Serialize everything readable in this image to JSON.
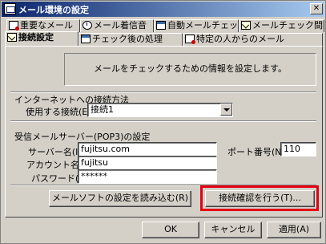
{
  "window": {
    "title": "メール環境の設定"
  },
  "tabs_row1": [
    {
      "label": "重要なメール"
    },
    {
      "label": "メール着信音"
    },
    {
      "label": "自動メールチェック"
    },
    {
      "label": "メールチェック間隔"
    }
  ],
  "tabs_row2": [
    {
      "label": "接続設定"
    },
    {
      "label": "チェック後の処理"
    },
    {
      "label": "特定の人からのメール"
    }
  ],
  "panel": {
    "info_text": "メールをチェックするための情報を設定します。",
    "internet_section": "インターネットへの接続方法",
    "connection_label": "使用する接続(E):",
    "connection_value": "接続1",
    "pop3_section": "受信メールサーバー(POP3)の設定",
    "server_label": "サーバー名(I):",
    "server_value": "fujitsu.com",
    "account_label": "アカウント名(C):",
    "account_value": "fujitsu",
    "password_label": "パスワード(P):",
    "password_value": "******",
    "port_label": "ポート番号(N):",
    "port_value": "110",
    "load_settings_button": "メールソフトの設定を読み込む(R)",
    "test_connection_button": "接続確認を行う(T)..."
  },
  "footer": {
    "ok_button": "OK",
    "cancel_button": "キャンセル",
    "apply_button": "適用(A)"
  },
  "colors": {
    "highlight": "#e60012"
  }
}
